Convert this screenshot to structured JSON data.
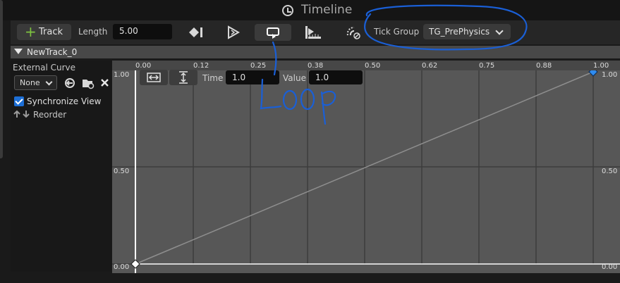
{
  "window": {
    "title": "Timeline"
  },
  "toolbar": {
    "add_track_label": "Track",
    "length_label": "Length",
    "length_value": "5.00",
    "tick_group_label": "Tick Group",
    "tick_group_value": "TG_PrePhysics"
  },
  "track": {
    "name": "NewTrack_0"
  },
  "left_panel": {
    "external_curve_label": "External Curve",
    "external_curve_value": "None",
    "sync_view_label": "Synchronize View",
    "sync_view_checked": true,
    "reorder_label": "Reorder"
  },
  "curve_editor": {
    "time_label": "Time",
    "time_value": "1.0",
    "value_label": "Value",
    "value_value": "1.0",
    "x_ticks": [
      "0.00",
      "0.12",
      "0.25",
      "0.38",
      "0.50",
      "0.62",
      "0.75",
      "0.88",
      "1.00"
    ],
    "y_ticks_left": [
      "1.00",
      "0.50",
      "0.00"
    ],
    "y_ticks_right": [
      "1.00",
      "0.50",
      "0.00"
    ]
  },
  "annotations": {
    "handwritten_note": "Loop",
    "ink_color": "#1a5fd6"
  },
  "colors": {
    "accent_blue": "#1d6fd6",
    "add_green": "#7ec340"
  }
}
